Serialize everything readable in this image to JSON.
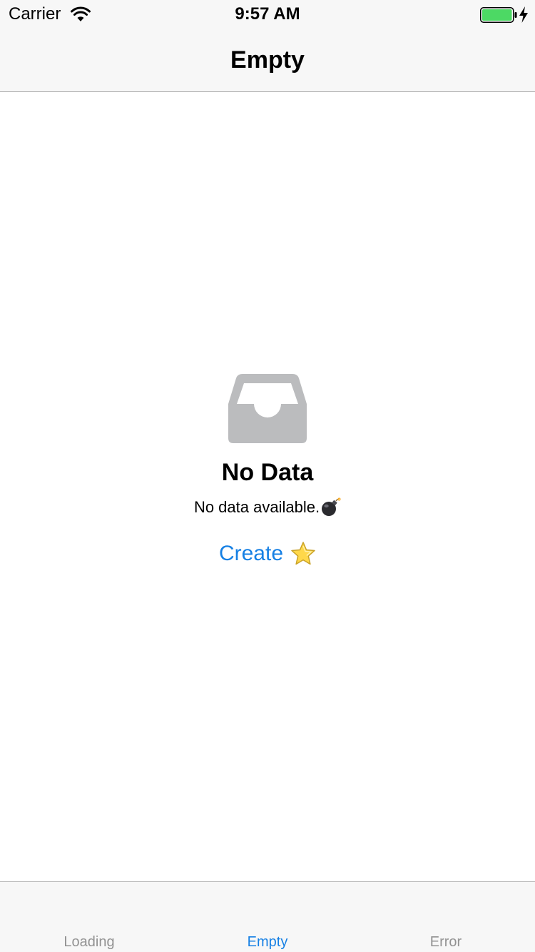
{
  "status_bar": {
    "carrier": "Carrier",
    "time": "9:57 AM",
    "wifi_icon": "wifi-icon",
    "battery_icon": "battery-full-icon",
    "charging_icon": "charging-bolt-icon",
    "battery_level": 1.0,
    "battery_color": "#4cd964"
  },
  "nav": {
    "title": "Empty"
  },
  "empty_state": {
    "icon": "inbox-tray-icon",
    "icon_color": "#bbbcbe",
    "title": "No Data",
    "description": "No data available.",
    "description_emoji": "bomb-icon",
    "button_label": "Create",
    "button_emoji": "star-icon",
    "accent_color": "#1680e4"
  },
  "tab_bar": {
    "tabs": [
      {
        "label": "Loading",
        "active": false
      },
      {
        "label": "Empty",
        "active": true
      },
      {
        "label": "Error",
        "active": false
      }
    ]
  }
}
